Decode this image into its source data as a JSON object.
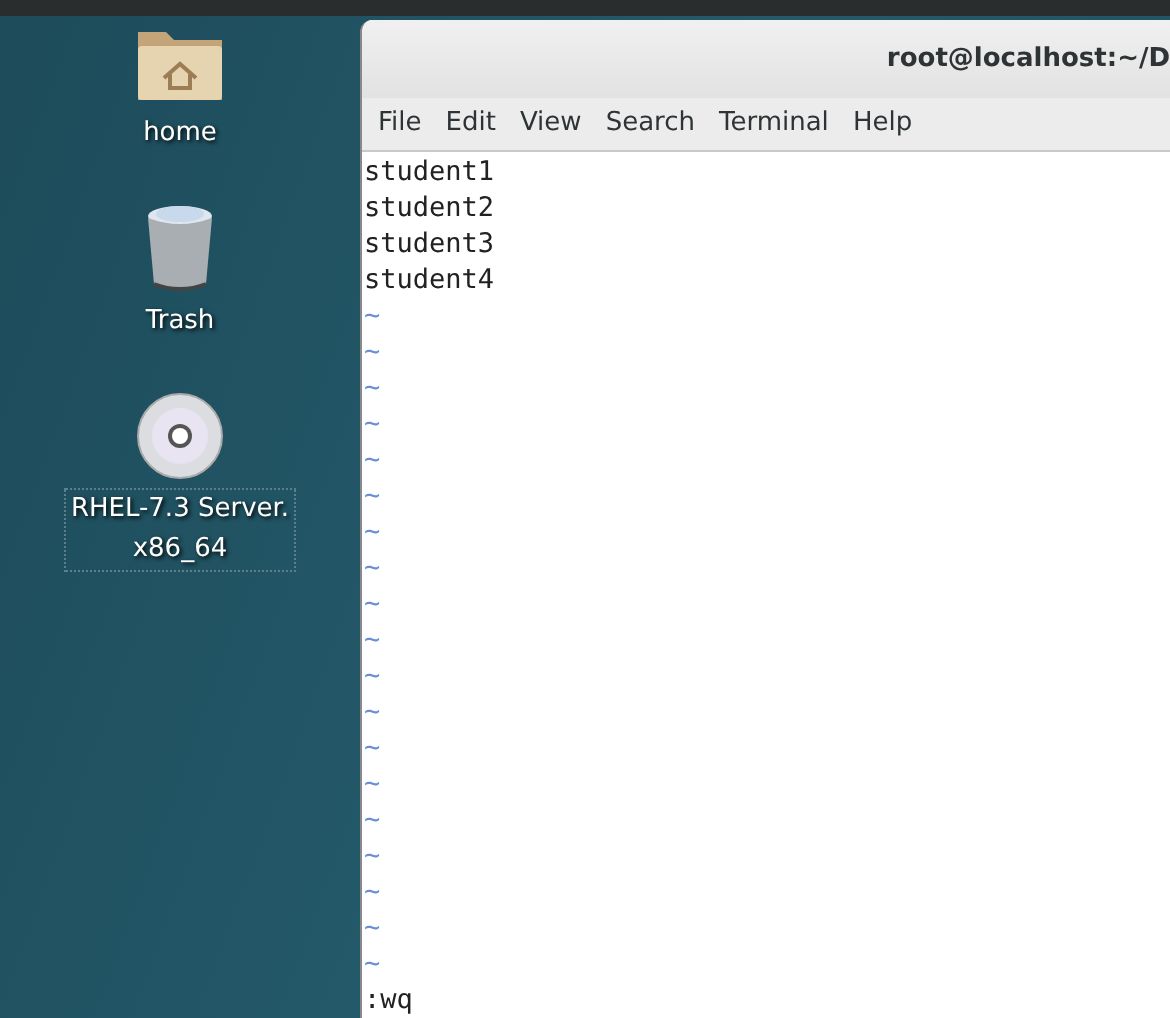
{
  "desktop_icons": [
    {
      "kind": "folder",
      "label": "home",
      "selected": false
    },
    {
      "kind": "trash",
      "label": "Trash",
      "selected": false
    },
    {
      "kind": "disc",
      "label": "RHEL-7.3 Server.\nx86_64",
      "selected": true
    }
  ],
  "window": {
    "title": "root@localhost:~/D"
  },
  "menu": [
    "File",
    "Edit",
    "View",
    "Search",
    "Terminal",
    "Help"
  ],
  "terminal": {
    "lines": [
      "student1",
      "student2",
      "student3",
      "student4"
    ],
    "empty_lines": [
      "~",
      "~",
      "~",
      "~",
      "~",
      "~",
      "~",
      "~",
      "~",
      "~",
      "~",
      "~",
      "~",
      "~",
      "~",
      "~",
      "~",
      "~",
      "~"
    ],
    "command_line": ":wq"
  }
}
